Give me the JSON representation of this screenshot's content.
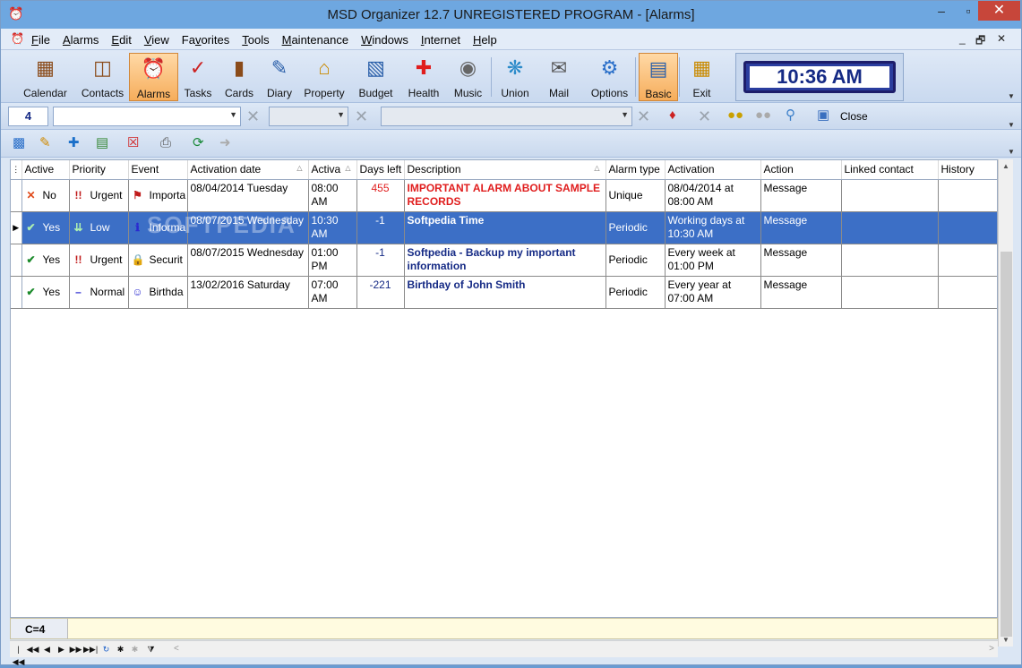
{
  "window": {
    "title": "MSD Organizer 12.7 UNREGISTERED PROGRAM - [Alarms]",
    "minimize": "–",
    "maximize": "▫",
    "close": "✕"
  },
  "menu": {
    "items": [
      {
        "label": "File",
        "ul": "F"
      },
      {
        "label": "Alarms",
        "ul": "A"
      },
      {
        "label": "Edit",
        "ul": "E"
      },
      {
        "label": "View",
        "ul": "V"
      },
      {
        "label": "Favorites",
        "ul": "v"
      },
      {
        "label": "Tools",
        "ul": "T"
      },
      {
        "label": "Maintenance",
        "ul": "M"
      },
      {
        "label": "Windows",
        "ul": "W"
      },
      {
        "label": "Internet",
        "ul": "I"
      },
      {
        "label": "Help",
        "ul": "H"
      }
    ],
    "mdi_min": "_",
    "mdi_restore": "🗗",
    "mdi_close": "✕"
  },
  "toolbar": {
    "buttons": [
      {
        "label": "Calendar",
        "icon": "calendar-icon"
      },
      {
        "label": "Contacts",
        "icon": "contacts-icon"
      },
      {
        "label": "Alarms",
        "icon": "alarm-clock-icon",
        "active": true
      },
      {
        "label": "Tasks",
        "icon": "tasks-icon"
      },
      {
        "label": "Cards",
        "icon": "cards-icon"
      },
      {
        "label": "Diary",
        "icon": "diary-icon"
      },
      {
        "label": "Property",
        "icon": "house-icon"
      },
      {
        "label": "Budget",
        "icon": "calculator-icon"
      },
      {
        "label": "Health",
        "icon": "red-cross-icon"
      },
      {
        "label": "Music",
        "icon": "cd-icon"
      },
      {
        "label": "Union",
        "icon": "puzzle-icon"
      },
      {
        "label": "Mail",
        "icon": "envelope-icon"
      },
      {
        "label": "Options",
        "icon": "gear-icon"
      },
      {
        "label": "Basic",
        "icon": "window-icon",
        "active": true
      },
      {
        "label": "Exit",
        "icon": "door-icon"
      }
    ],
    "clock": "10:36 AM"
  },
  "filter": {
    "count": "4",
    "close_label": "Close"
  },
  "grid": {
    "columns": [
      "Active",
      "Priority",
      "Event",
      "Activation date",
      "Activa",
      "Days left",
      "Description",
      "Alarm type",
      "Activation",
      "Action",
      "Linked contact",
      "History"
    ],
    "rows": [
      {
        "active": "No",
        "active_icon": "x-icon",
        "priority": "Urgent",
        "priority_icon": "urgent-icon",
        "event": "Importa",
        "event_icon": "red-flag-icon",
        "date": "08/04/2014 Tuesday",
        "time": "08:00 AM",
        "days": "455",
        "days_color": "red",
        "description": "IMPORTANT ALARM ABOUT SAMPLE RECORDS",
        "desc_color": "red",
        "type": "Unique",
        "activation": "08/04/2014 at 08:00 AM",
        "action": "Message",
        "linked": "",
        "history": ""
      },
      {
        "active": "Yes",
        "active_icon": "checkmark-icon",
        "priority": "Low",
        "priority_icon": "low-icon",
        "event": "Informa",
        "event_icon": "info-icon",
        "date": "08/07/2015 Wednesday",
        "time": "10:30 AM",
        "days": "-1",
        "days_color": "blue",
        "description": "Softpedia Time",
        "desc_color": "blue",
        "type": "Periodic",
        "activation": "Working days at 10:30 AM",
        "action": "Message",
        "linked": "",
        "history": "",
        "selected": true
      },
      {
        "active": "Yes",
        "active_icon": "checkmark-icon",
        "priority": "Urgent",
        "priority_icon": "urgent-icon",
        "event": "Securit",
        "event_icon": "lock-icon",
        "date": "08/07/2015 Wednesday",
        "time": "01:00 PM",
        "days": "-1",
        "days_color": "blue",
        "description": "Softpedia - Backup my important information",
        "desc_color": "blue",
        "type": "Periodic",
        "activation": "Every week at 01:00 PM",
        "action": "Message",
        "linked": "",
        "history": ""
      },
      {
        "active": "Yes",
        "active_icon": "checkmark-icon",
        "priority": "Normal",
        "priority_icon": "normal-icon",
        "event": "Birthda",
        "event_icon": "smiley-icon",
        "date": "13/02/2016 Saturday",
        "time": "07:00 AM",
        "days": "-221",
        "days_color": "blue",
        "description": "Birthday of John Smith",
        "desc_color": "blue",
        "type": "Periodic",
        "activation": "Every year at 07:00 AM",
        "action": "Message",
        "linked": "",
        "history": ""
      }
    ],
    "watermark": "SOFTPEDIA"
  },
  "footer": {
    "count_label": "C=4"
  }
}
